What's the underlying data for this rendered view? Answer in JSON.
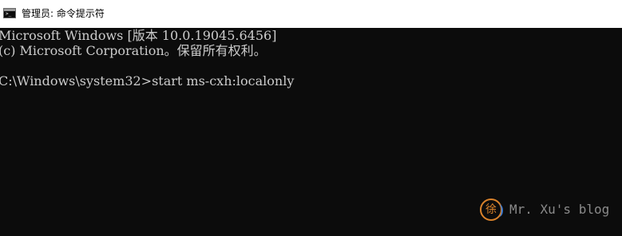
{
  "window": {
    "title": "管理员: 命令提示符",
    "app_icon": "cmd-icon",
    "titlebar_color": "#ffffff",
    "background_color": "#0c0c0c",
    "text_color": "#cccccc"
  },
  "console": {
    "lines": [
      "Microsoft Windows [版本 10.0.19045.6456]",
      "(c) Microsoft Corporation。保留所有权利。",
      "",
      "C:\\Windows\\system32>start ms-cxh:localonly"
    ]
  },
  "watermark": {
    "logo_char": "徐",
    "text": "Mr. Xu's blog",
    "logo_colors": [
      "#d9822b",
      "#3a7bd5"
    ]
  }
}
